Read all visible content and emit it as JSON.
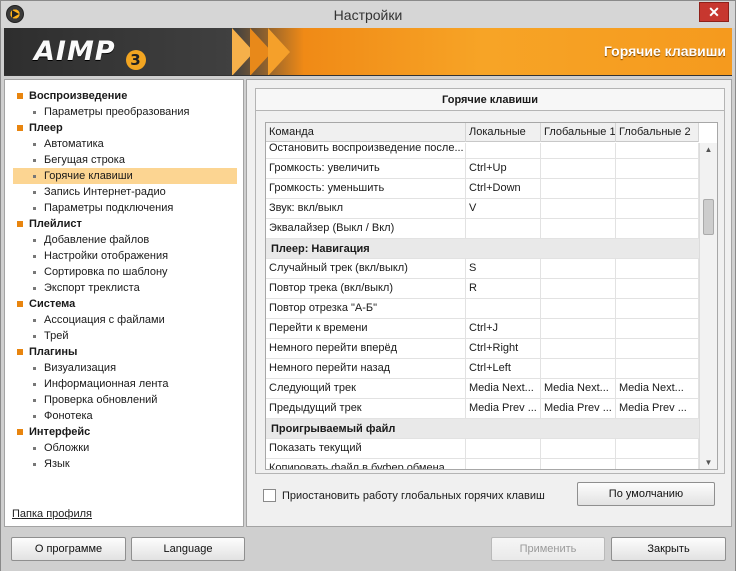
{
  "window": {
    "title": "Настройки",
    "close_glyph": "✕"
  },
  "banner": {
    "logo": "AIMP",
    "logo_version": "3",
    "section_title": "Горячие клавиши"
  },
  "sidebar": {
    "items": [
      {
        "label": "Воспроизведение",
        "kind": "cat"
      },
      {
        "label": "Параметры преобразования",
        "kind": "sub"
      },
      {
        "label": "Плеер",
        "kind": "cat"
      },
      {
        "label": "Автоматика",
        "kind": "sub"
      },
      {
        "label": "Бегущая строка",
        "kind": "sub"
      },
      {
        "label": "Горячие клавиши",
        "kind": "sub",
        "selected": true
      },
      {
        "label": "Запись Интернет-радио",
        "kind": "sub"
      },
      {
        "label": "Параметры подключения",
        "kind": "sub"
      },
      {
        "label": "Плейлист",
        "kind": "cat"
      },
      {
        "label": "Добавление файлов",
        "kind": "sub"
      },
      {
        "label": "Настройки отображения",
        "kind": "sub"
      },
      {
        "label": "Сортировка по шаблону",
        "kind": "sub"
      },
      {
        "label": "Экспорт треклиста",
        "kind": "sub"
      },
      {
        "label": "Система",
        "kind": "cat"
      },
      {
        "label": "Ассоциация с файлами",
        "kind": "sub"
      },
      {
        "label": "Трей",
        "kind": "sub"
      },
      {
        "label": "Плагины",
        "kind": "cat"
      },
      {
        "label": "Визуализация",
        "kind": "sub"
      },
      {
        "label": "Информационная лента",
        "kind": "sub"
      },
      {
        "label": "Проверка обновлений",
        "kind": "sub"
      },
      {
        "label": "Фонотека",
        "kind": "sub"
      },
      {
        "label": "Интерфейс",
        "kind": "cat"
      },
      {
        "label": "Обложки",
        "kind": "sub"
      },
      {
        "label": "Язык",
        "kind": "sub"
      }
    ],
    "profile_link": "Папка профиля"
  },
  "main": {
    "section_title": "Горячие клавиши",
    "columns": [
      "Команда",
      "Локальные",
      "Глобальные 1",
      "Глобальные 2"
    ],
    "rows": [
      {
        "type": "cmd",
        "cells": [
          "Остановить воспроизведение после...",
          "",
          "",
          ""
        ]
      },
      {
        "type": "cmd",
        "cells": [
          "Громкость: увеличить",
          "Ctrl+Up",
          "",
          ""
        ]
      },
      {
        "type": "cmd",
        "cells": [
          "Громкость: уменьшить",
          "Ctrl+Down",
          "",
          ""
        ]
      },
      {
        "type": "cmd",
        "cells": [
          "Звук: вкл/выкл",
          "V",
          "",
          ""
        ]
      },
      {
        "type": "cmd",
        "cells": [
          "Эквалайзер (Выкл / Вкл)",
          "",
          "",
          ""
        ]
      },
      {
        "type": "group",
        "label": "Плеер: Навигация"
      },
      {
        "type": "cmd",
        "cells": [
          "Случайный трек (вкл/выкл)",
          "S",
          "",
          ""
        ]
      },
      {
        "type": "cmd",
        "cells": [
          "Повтор трека (вкл/выкл)",
          "R",
          "",
          ""
        ]
      },
      {
        "type": "cmd",
        "cells": [
          "Повтор отрезка \"А-Б\"",
          "",
          "",
          ""
        ]
      },
      {
        "type": "cmd",
        "cells": [
          "Перейти к времени",
          "Ctrl+J",
          "",
          ""
        ]
      },
      {
        "type": "cmd",
        "cells": [
          "Немного перейти вперёд",
          "Ctrl+Right",
          "",
          ""
        ]
      },
      {
        "type": "cmd",
        "cells": [
          "Немного перейти назад",
          "Ctrl+Left",
          "",
          ""
        ]
      },
      {
        "type": "cmd",
        "cells": [
          "Следующий трек",
          "Media Next...",
          "Media Next...",
          "Media Next..."
        ]
      },
      {
        "type": "cmd",
        "cells": [
          "Предыдущий трек",
          "Media Prev ...",
          "Media Prev ...",
          "Media Prev ..."
        ]
      },
      {
        "type": "group",
        "label": "Проигрываемый файл"
      },
      {
        "type": "cmd",
        "cells": [
          "Показать текущий",
          "",
          "",
          ""
        ]
      },
      {
        "type": "cmd",
        "cells": [
          "Копировать файл в буфер обмена",
          "",
          "",
          ""
        ]
      }
    ],
    "suspend_checkbox_label": "Приостановить работу глобальных горячих клавиш",
    "suspend_checked": false,
    "default_button": "По умолчанию"
  },
  "footer": {
    "about": "О программе",
    "language": "Language",
    "apply": "Применить",
    "close": "Закрыть"
  }
}
